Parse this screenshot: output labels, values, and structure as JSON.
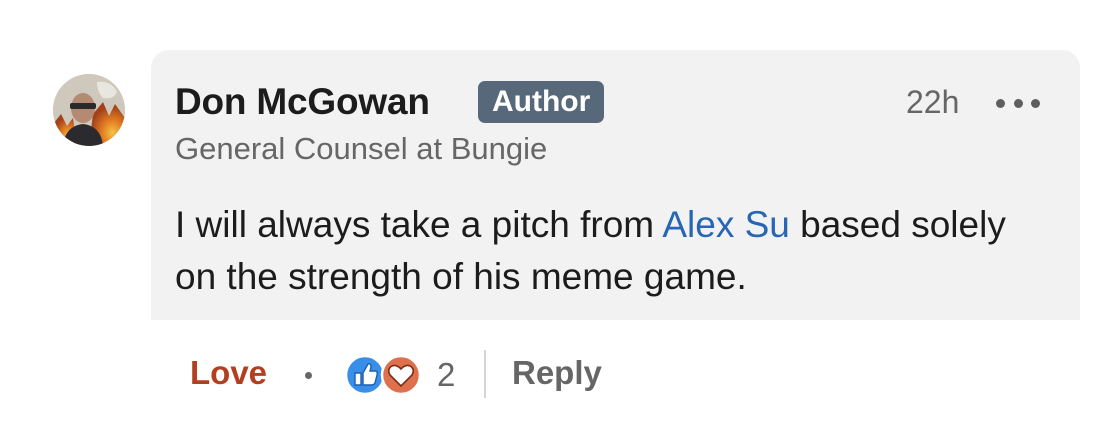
{
  "comment": {
    "author_name": "Don McGowan",
    "author_badge": "Author",
    "author_headline": "General Counsel at Bungie",
    "timestamp": "22h",
    "more_icon": "more-horizontal-icon",
    "avatar_icon": "profile-photo",
    "text_before": "I will always take a pitch from ",
    "mention": "Alex Su",
    "text_after": " based solely on the strength of his meme game."
  },
  "actions": {
    "love_label": "Love",
    "reaction_icons": [
      "like-icon",
      "love-icon"
    ],
    "reaction_count": "2",
    "reply_label": "Reply"
  },
  "colors": {
    "bubble_bg": "#f2f2f2",
    "badge_bg": "#56687a",
    "mention": "#2866b5",
    "love_active": "#b24020",
    "like_blue": "#378fe9",
    "love_orange": "#df704d"
  }
}
